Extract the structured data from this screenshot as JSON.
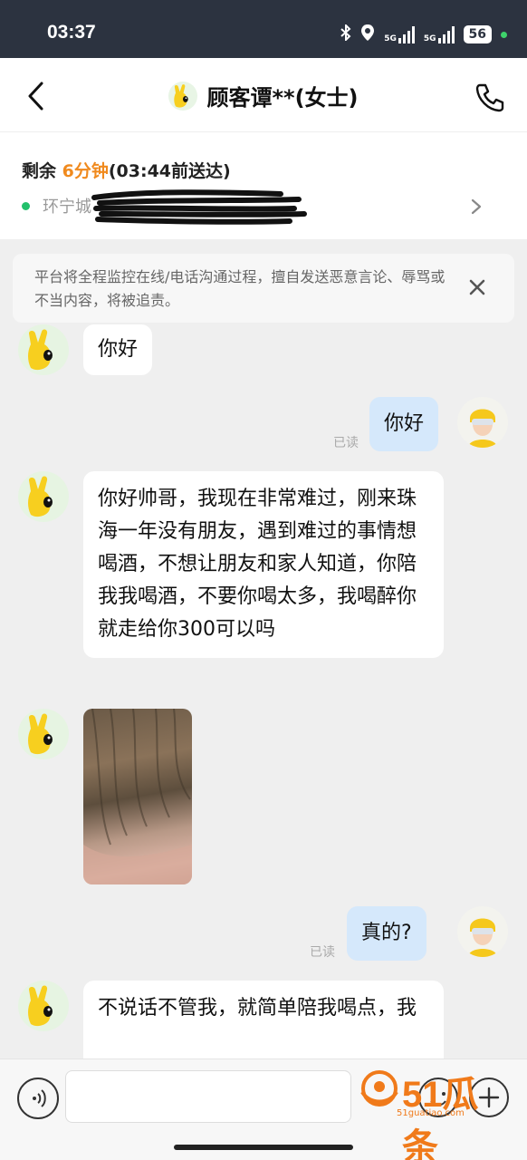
{
  "status_bar": {
    "time": "03:37",
    "net1": "5G",
    "net2": "5G",
    "battery": "56"
  },
  "header": {
    "title": "顾客谭**(女士)"
  },
  "order": {
    "remaining_prefix": "剩余 ",
    "remaining_minutes": "6分钟",
    "deadline": "(03:44前送达)",
    "address_visible": "环宁城"
  },
  "notice": {
    "text": "平台将全程监控在线/电话沟通过程，擅自发送恶意言论、辱骂或不当内容，将被追责。"
  },
  "messages": [
    {
      "from": "customer",
      "text": "你好"
    },
    {
      "from": "me",
      "text": "你好",
      "status": "已读"
    },
    {
      "from": "customer",
      "text": "你好帅哥，我现在非常难过，刚来珠海一年没有朋友，遇到难过的事情想喝酒，不想让朋友和家人知道，你陪我我喝酒，不要你喝太多，我喝醉你就走给你300可以吗"
    },
    {
      "from": "customer",
      "type": "image"
    },
    {
      "from": "me",
      "text": "真的?",
      "status": "已读"
    },
    {
      "from": "customer",
      "text": "不说话不管我，就简单陪我喝点，我"
    }
  ],
  "input": {
    "placeholder": ""
  },
  "watermark": {
    "text": "51瓜条",
    "url": "51guatiao.com"
  },
  "colors": {
    "accent_orange": "#f08a1e",
    "bubble_me": "#d5e8fb",
    "status_bar": "#2c3340"
  }
}
